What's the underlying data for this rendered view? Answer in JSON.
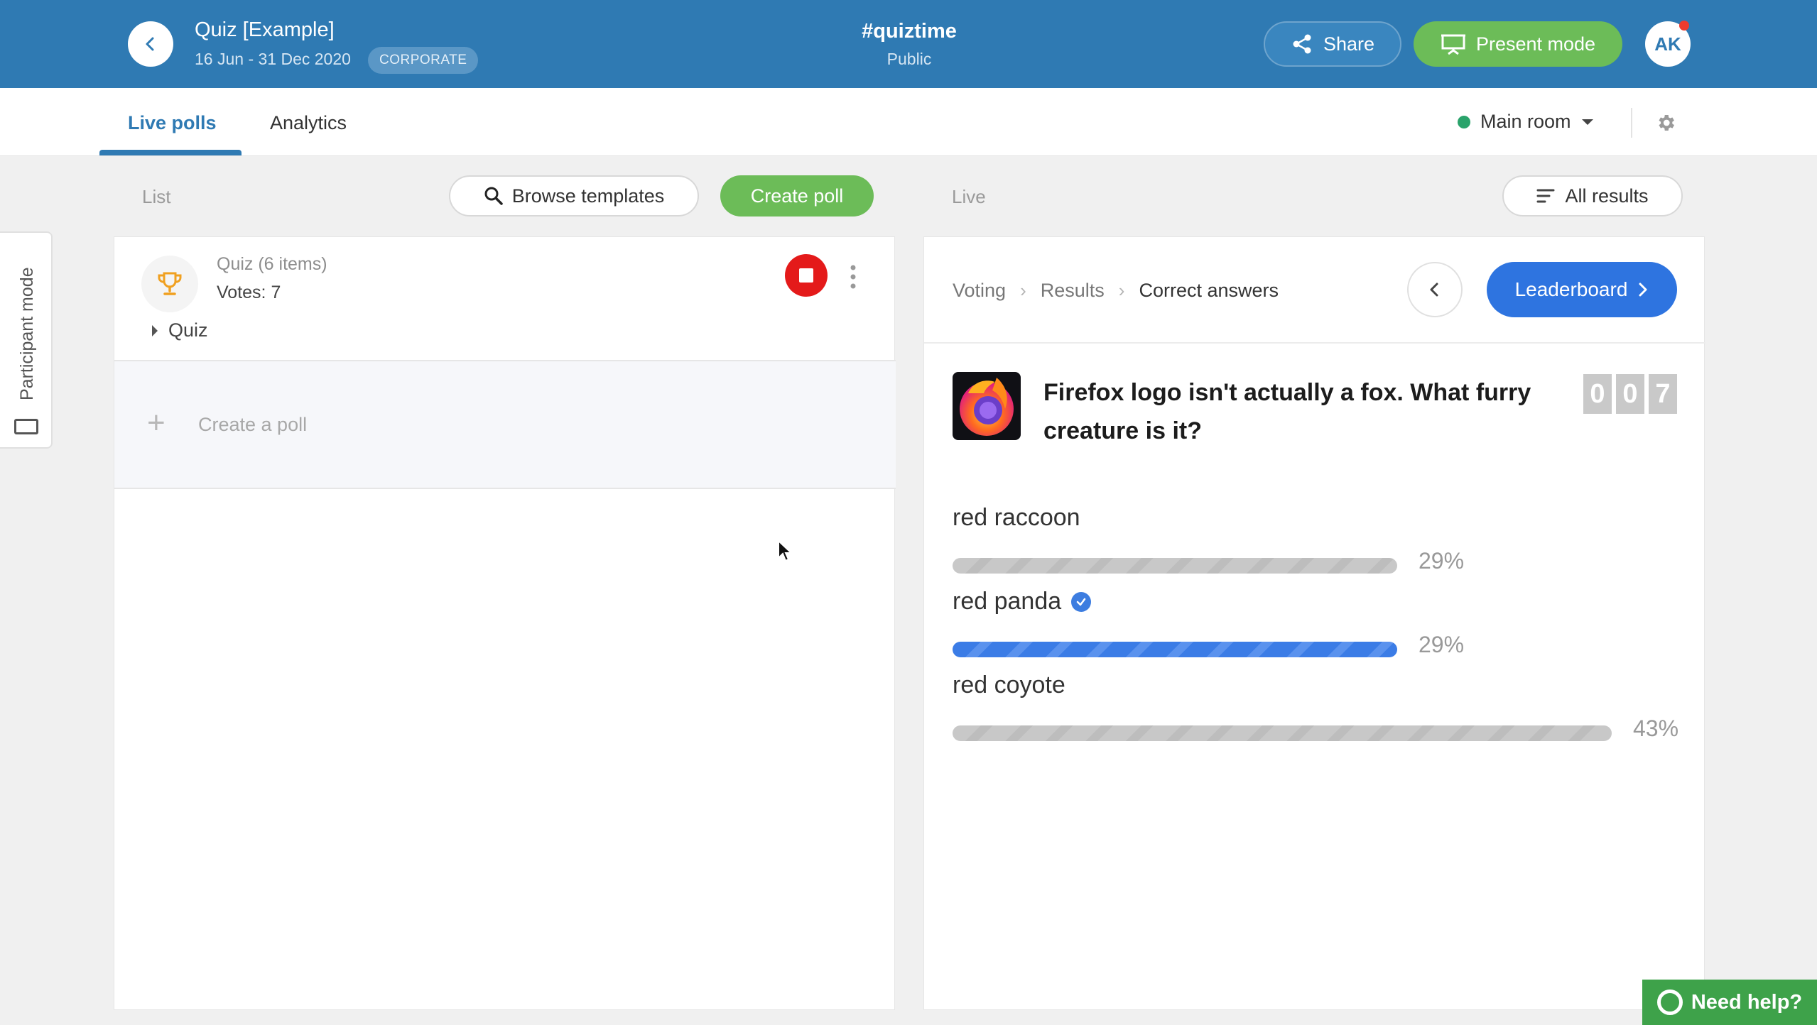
{
  "header": {
    "event_title": "Quiz [Example]",
    "event_dates": "16 Jun - 31 Dec 2020",
    "plan_badge": "CORPORATE",
    "hashtag": "#quiztime",
    "visibility": "Public",
    "share_label": "Share",
    "present_label": "Present mode",
    "avatar_initials": "AK"
  },
  "tabs": {
    "live_polls": "Live polls",
    "analytics": "Analytics",
    "room": "Main room"
  },
  "toolbar": {
    "list_label": "List",
    "browse_label": "Browse templates",
    "create_label": "Create poll",
    "live_label": "Live",
    "all_results_label": "All results"
  },
  "participant_mode": "Participant mode",
  "list": {
    "poll_type": "Quiz (6 items)",
    "votes": "Votes: 7",
    "group": "Quiz",
    "create_poll": "Create a poll"
  },
  "live": {
    "crumbs": [
      "Voting",
      "Results",
      "Correct answers"
    ],
    "leaderboard_label": "Leaderboard",
    "question": "Firefox logo isn't actually a fox. What furry creature is it?",
    "timer": [
      "0",
      "0",
      "7"
    ],
    "answers": [
      {
        "label": "red raccoon",
        "percent": "29%",
        "value": 29,
        "correct": false
      },
      {
        "label": "red panda",
        "percent": "29%",
        "value": 29,
        "correct": true
      },
      {
        "label": "red coyote",
        "percent": "43%",
        "value": 43,
        "correct": false
      }
    ]
  },
  "help": {
    "label": "Need help?"
  },
  "colors": {
    "header_blue": "#2f7ab3",
    "green": "#6cbc58",
    "stop_red": "#e41a1a",
    "correct_blue": "#3b7ce6"
  }
}
